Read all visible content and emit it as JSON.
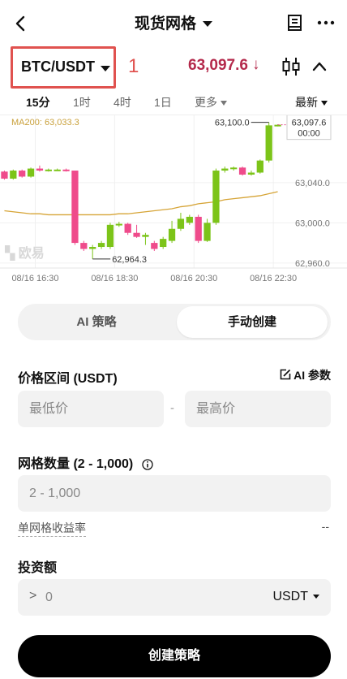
{
  "header": {
    "title": "现货网格"
  },
  "pair": {
    "label": "BTC/USDT",
    "annotation": "1",
    "price": "63,097.6",
    "price_arrow": "↓"
  },
  "timeframes": {
    "items": [
      {
        "label": "15分",
        "active": true
      },
      {
        "label": "1时",
        "active": false
      },
      {
        "label": "4时",
        "active": false
      },
      {
        "label": "1日",
        "active": false
      }
    ],
    "more": "更多",
    "latest": "最新"
  },
  "chart_data": {
    "type": "candlestick",
    "indicator_label": "MA200: 63,033.3",
    "watermark": "欧易",
    "y_ticks": [
      "63,040.0",
      "63,000.0",
      "62,960.0"
    ],
    "y_tick_values": [
      63040,
      63000,
      62960
    ],
    "ylim": [
      62955,
      63107
    ],
    "x_ticks": [
      "08/16 16:30",
      "08/16 18:30",
      "08/16 20:30",
      "08/16 22:30"
    ],
    "high_annotation": "63,100.0",
    "low_annotation": "62,964.3",
    "last_price_tag": "63,097.6",
    "countdown": "00:00",
    "candles": [
      {
        "o": 63051,
        "c": 63044,
        "h": 63052,
        "l": 63043
      },
      {
        "o": 63044,
        "c": 63052,
        "h": 63053,
        "l": 63043
      },
      {
        "o": 63052,
        "c": 63046,
        "h": 63053,
        "l": 63045
      },
      {
        "o": 63046,
        "c": 63054,
        "h": 63055,
        "l": 63045
      },
      {
        "o": 63054,
        "c": 63052,
        "h": 63057,
        "l": 63051
      },
      {
        "o": 63052,
        "c": 63053,
        "h": 63054,
        "l": 63051
      },
      {
        "o": 63053,
        "c": 63053,
        "h": 63054,
        "l": 63052
      },
      {
        "o": 63053,
        "c": 63052,
        "h": 63054,
        "l": 63051
      },
      {
        "o": 63052,
        "c": 62980,
        "h": 63052,
        "l": 62978
      },
      {
        "o": 62980,
        "c": 62974,
        "h": 62982,
        "l": 62972
      },
      {
        "o": 62974,
        "c": 62976,
        "h": 62978,
        "l": 62964
      },
      {
        "o": 62976,
        "c": 62980,
        "h": 62982,
        "l": 62974
      },
      {
        "o": 62976,
        "c": 62998,
        "h": 63000,
        "l": 62974
      },
      {
        "o": 62998,
        "c": 62999,
        "h": 63001,
        "l": 62996
      },
      {
        "o": 62999,
        "c": 62990,
        "h": 63000,
        "l": 62988
      },
      {
        "o": 62990,
        "c": 62986,
        "h": 62998,
        "l": 62985
      },
      {
        "o": 62986,
        "c": 62988,
        "h": 62990,
        "l": 62978
      },
      {
        "o": 62980,
        "c": 62974,
        "h": 62982,
        "l": 62972
      },
      {
        "o": 62976,
        "c": 62984,
        "h": 62986,
        "l": 62974
      },
      {
        "o": 62982,
        "c": 62994,
        "h": 63002,
        "l": 62980
      },
      {
        "o": 62994,
        "c": 63004,
        "h": 63010,
        "l": 62992
      },
      {
        "o": 63000,
        "c": 63006,
        "h": 63008,
        "l": 62998
      },
      {
        "o": 63006,
        "c": 62982,
        "h": 63008,
        "l": 62980
      },
      {
        "o": 62982,
        "c": 63000,
        "h": 63004,
        "l": 62981
      },
      {
        "o": 63000,
        "c": 63052,
        "h": 63054,
        "l": 62998
      },
      {
        "o": 63052,
        "c": 63054,
        "h": 63056,
        "l": 63050
      },
      {
        "o": 63054,
        "c": 63055,
        "h": 63056,
        "l": 63052
      },
      {
        "o": 63055,
        "c": 63048,
        "h": 63056,
        "l": 63047
      },
      {
        "o": 63048,
        "c": 63050,
        "h": 63052,
        "l": 63047
      },
      {
        "o": 63050,
        "c": 63062,
        "h": 63063,
        "l": 63049
      },
      {
        "o": 63062,
        "c": 63097,
        "h": 63100,
        "l": 63060
      },
      {
        "o": 63097,
        "c": 63097.6,
        "h": 63098,
        "l": 63096
      }
    ],
    "ma200": [
      63012,
      63011,
      63010,
      63009,
      63009,
      63008,
      63008,
      63008,
      63008,
      63008,
      63008,
      63008,
      63008,
      63009,
      63009,
      63010,
      63011,
      63012,
      63013,
      63014,
      63016,
      63017,
      63019,
      63020,
      63021,
      63023,
      63024,
      63025,
      63026,
      63027,
      63029,
      63031
    ],
    "colors": {
      "up": "#7cc419",
      "down": "#ef4b8b",
      "ma": "#d6a436",
      "last": "#e44b8a"
    }
  },
  "mode": {
    "ai": "AI 策略",
    "manual": "手动创建"
  },
  "range": {
    "label": "价格区间 (USDT)",
    "ai_param": "AI 参数",
    "min_placeholder": "最低价",
    "dash": "-",
    "max_placeholder": "最高价"
  },
  "grid": {
    "label": "网格数量 (2 - 1,000)",
    "placeholder": "2 - 1,000",
    "yield_label": "单网格收益率",
    "yield_value": "--"
  },
  "invest": {
    "label": "投资额",
    "prefix": ">",
    "placeholder": "0",
    "unit": "USDT"
  },
  "submit": {
    "label": "创建策略"
  }
}
